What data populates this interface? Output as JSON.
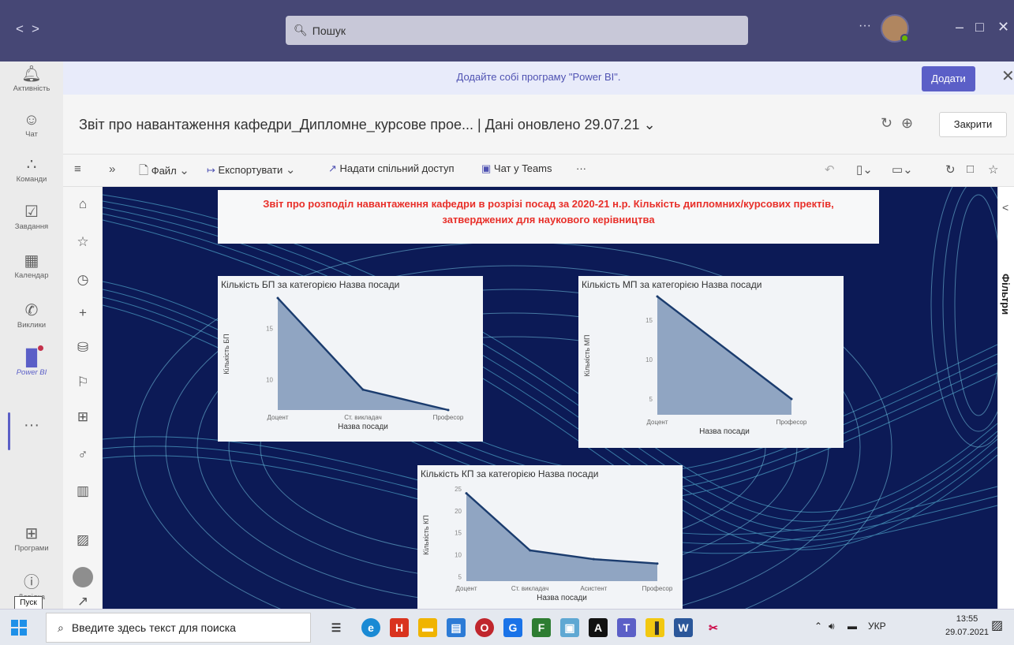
{
  "titlebar": {
    "search_placeholder": "Пошук",
    "more": "···"
  },
  "rail": {
    "items": [
      {
        "label": "Активність",
        "icon": "bell-icon"
      },
      {
        "label": "Чат",
        "icon": "chat-icon"
      },
      {
        "label": "Команди",
        "icon": "teams-icon"
      },
      {
        "label": "Завдання",
        "icon": "tasks-icon"
      },
      {
        "label": "Календар",
        "icon": "calendar-icon"
      },
      {
        "label": "Виклики",
        "icon": "phone-icon"
      },
      {
        "label": "Power BI",
        "icon": "powerbi-icon"
      },
      {
        "label": "···",
        "icon": "more-icon"
      },
      {
        "label": "Програми",
        "icon": "apps-icon"
      },
      {
        "label": "Довідка",
        "icon": "help-icon"
      }
    ],
    "tooltip": "Пуск"
  },
  "banner": {
    "message": "Додайте собі програму \"Power BI\".",
    "add_label": "Додати"
  },
  "report_header": {
    "title": "Звіт про навантаження кафедри_Дипломне_курсове прое...",
    "separator": "|",
    "updated": "Дані оновлено 29.07.21",
    "close_label": "Закрити"
  },
  "toolbar": {
    "file": "Файл",
    "export": "Експортувати",
    "share": "Надати спільний доступ",
    "chat": "Чат у Teams",
    "more": "···"
  },
  "report": {
    "title": "Звіт про розподіл навантаження кафедри в розрізі посад за 2020-21 н.р. Кількість дипломних/курсових пректів, затверджених для наукового керівництва"
  },
  "filters": {
    "label": "Фільтри"
  },
  "chart_data": [
    {
      "type": "area",
      "title": "Кількість БП за категорією Назва посади",
      "xlabel": "Назва посади",
      "ylabel": "Кількість БП",
      "categories": [
        "Доцент",
        "Ст. викладач",
        "Професор"
      ],
      "values": [
        18,
        9,
        7
      ],
      "ylim": [
        7,
        18
      ],
      "yticks": [
        10,
        15
      ],
      "grid": false
    },
    {
      "type": "area",
      "title": "Кількість МП за категорією Назва посади",
      "xlabel": "Назва посади",
      "ylabel": "Кількість МП",
      "categories": [
        "Доцент",
        "Професор"
      ],
      "values": [
        18,
        5
      ],
      "ylim": [
        3,
        18
      ],
      "yticks": [
        5,
        10,
        15
      ],
      "grid": false
    },
    {
      "type": "area",
      "title": "Кількість КП за категорією Назва посади",
      "xlabel": "Назва посади",
      "ylabel": "Кількість КП",
      "categories": [
        "Доцент",
        "Ст. викладач",
        "Асистент",
        "Професор"
      ],
      "values": [
        24,
        11,
        9,
        8
      ],
      "ylim": [
        4,
        25
      ],
      "yticks": [
        5,
        10,
        15,
        20,
        25
      ],
      "grid": false
    }
  ],
  "taskbar": {
    "search_placeholder": "Введите здесь текст для поиска",
    "lang": "УКР",
    "time": "13:55",
    "date": "29.07.2021",
    "notif_count": "11"
  }
}
